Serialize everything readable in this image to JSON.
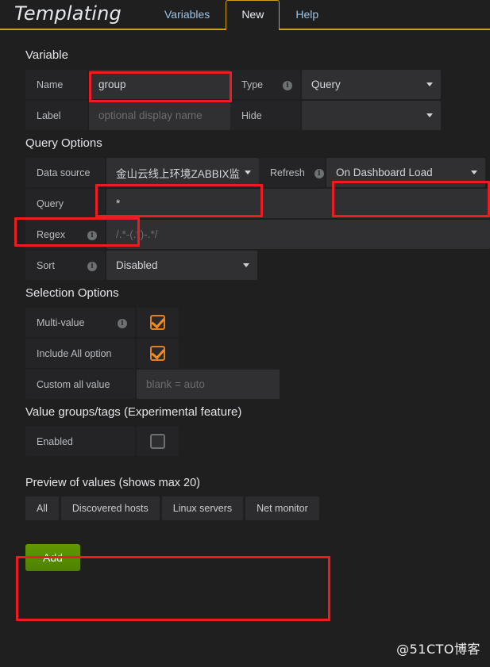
{
  "header": {
    "app_title": "Templating",
    "tabs": [
      {
        "label": "Variables",
        "active": false
      },
      {
        "label": "New",
        "active": true
      },
      {
        "label": "Help",
        "active": false
      }
    ],
    "accent_color": "#cfa018"
  },
  "variable_section": {
    "title": "Variable",
    "name_label": "Name",
    "name_value": "group",
    "type_label": "Type",
    "type_value": "Query",
    "label_label": "Label",
    "label_placeholder": "optional display name",
    "hide_label": "Hide",
    "hide_value": ""
  },
  "query_options": {
    "title": "Query Options",
    "data_source_label": "Data source",
    "data_source_value": "金山云线上环境ZABBIX监",
    "refresh_label": "Refresh",
    "refresh_value": "On Dashboard Load",
    "query_label": "Query",
    "query_value": "*",
    "regex_label": "Regex",
    "regex_placeholder": "/.*-(.*)-.*/",
    "sort_label": "Sort",
    "sort_value": "Disabled"
  },
  "selection_options": {
    "title": "Selection Options",
    "multi_value_label": "Multi-value",
    "multi_value_checked": true,
    "include_all_label": "Include All option",
    "include_all_checked": true,
    "custom_all_label": "Custom all value",
    "custom_all_placeholder": "blank = auto"
  },
  "value_groups": {
    "title": "Value groups/tags (Experimental feature)",
    "enabled_label": "Enabled",
    "enabled_checked": false
  },
  "preview": {
    "title": "Preview of values (shows max 20)",
    "values": [
      "All",
      "Discovered hosts",
      "Linux servers",
      "Net monitor"
    ]
  },
  "footer": {
    "add_label": "Add",
    "watermark": "@51CTO博客",
    "add_color": "#5c9200"
  },
  "annotations": {
    "highlight_color": "#ee1c22"
  }
}
